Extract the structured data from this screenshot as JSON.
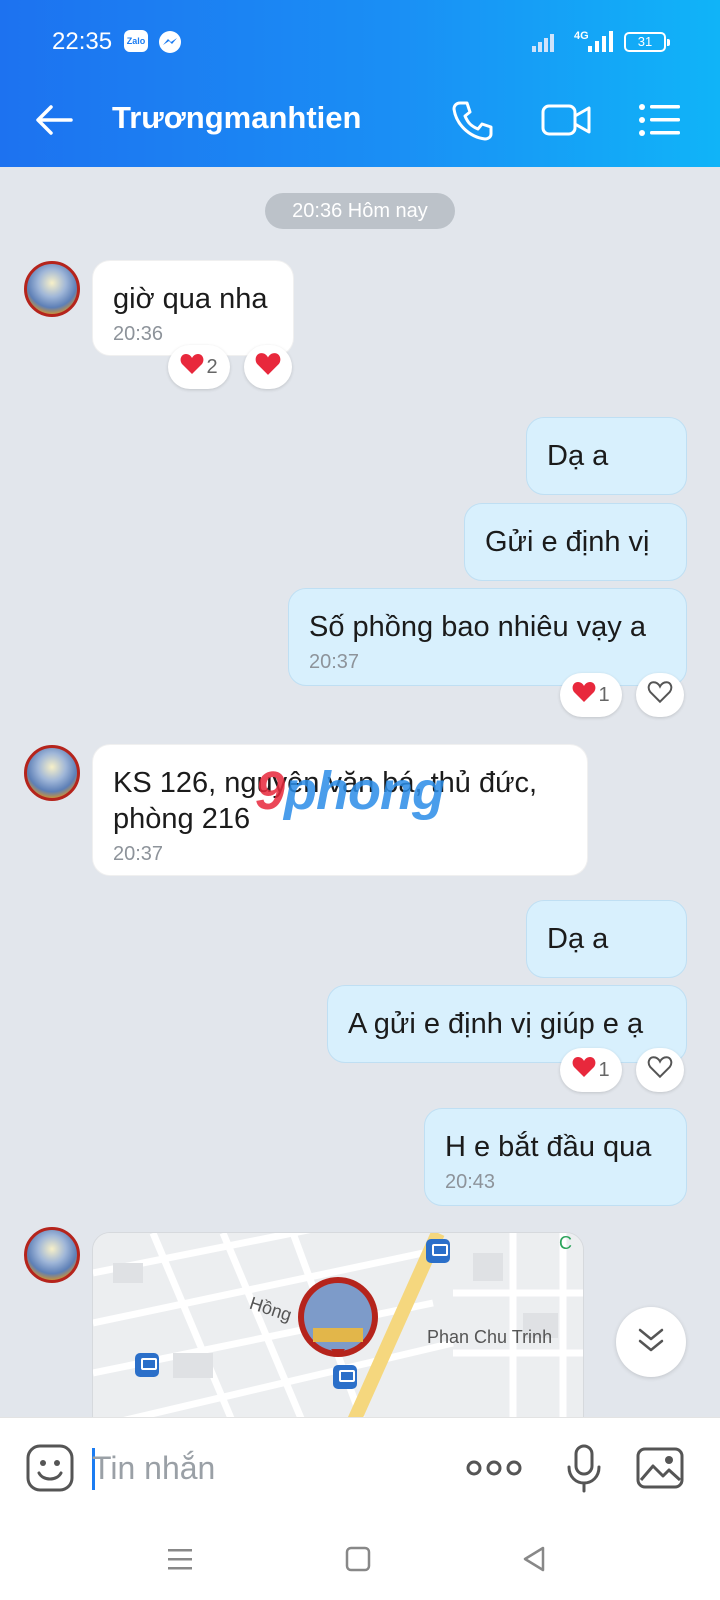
{
  "status_bar": {
    "time": "22:35",
    "app1": "Zalo",
    "network": "4G",
    "battery": "31"
  },
  "header": {
    "title": "Trươngmanhtien"
  },
  "chat": {
    "date_divider": "20:36 Hôm nay",
    "messages": [
      {
        "side": "in",
        "text": "giờ qua nha",
        "time": "20:36",
        "reaction_count": "2"
      },
      {
        "side": "out",
        "text": "Dạ a"
      },
      {
        "side": "out",
        "text": "Gửi e định vị"
      },
      {
        "side": "out",
        "text": "Số phồng bao nhiêu vạy a",
        "time": "20:37",
        "reaction_count": "1"
      },
      {
        "side": "in",
        "text": "KS 126, nguyên văn bá, thủ đức,\nphòng 216",
        "time": "20:37"
      },
      {
        "side": "out",
        "text": "Dạ a"
      },
      {
        "side": "out",
        "text": "A gửi e định vị giúp e ạ",
        "reaction_count": "1"
      },
      {
        "side": "out",
        "text": "H e bắt đầu qua",
        "time": "20:43"
      }
    ],
    "map": {
      "street1": "Phan Chu Trinh",
      "street2": "Hồng",
      "corner": "C"
    }
  },
  "watermark": {
    "part1": "9",
    "part2": "phong"
  },
  "composer": {
    "placeholder": "Tin nhắn"
  },
  "colors": {
    "header_start": "#1d72f0",
    "header_end": "#10b4f8",
    "outgoing_bubble": "#d8f0fd",
    "background": "#e2e6ec",
    "heart": "#e8283c"
  }
}
